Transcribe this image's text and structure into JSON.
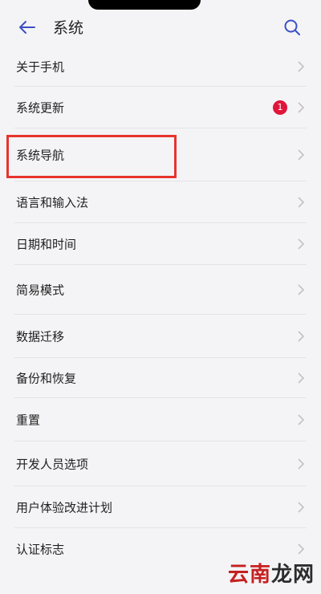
{
  "header": {
    "title": "系统",
    "back_icon": "arrow-left-icon",
    "search_icon": "search-icon",
    "accent": "#3d4fc4"
  },
  "settings": [
    {
      "label": "关于手机"
    },
    {
      "label": "系统更新",
      "badge": "1"
    },
    {
      "label": "系统导航"
    },
    {
      "label": "语言和输入法"
    },
    {
      "label": "日期和时间"
    },
    {
      "label": "简易模式"
    },
    {
      "label": "数据迁移"
    },
    {
      "label": "备份和恢复"
    },
    {
      "label": "重置"
    },
    {
      "label": "开发人员选项"
    },
    {
      "label": "用户体验改进计划"
    },
    {
      "label": "认证标志"
    }
  ],
  "badge_color": "#e0153a",
  "highlight_color": "#e8332d",
  "watermark": {
    "part1": "云南",
    "part2": "龙网"
  }
}
